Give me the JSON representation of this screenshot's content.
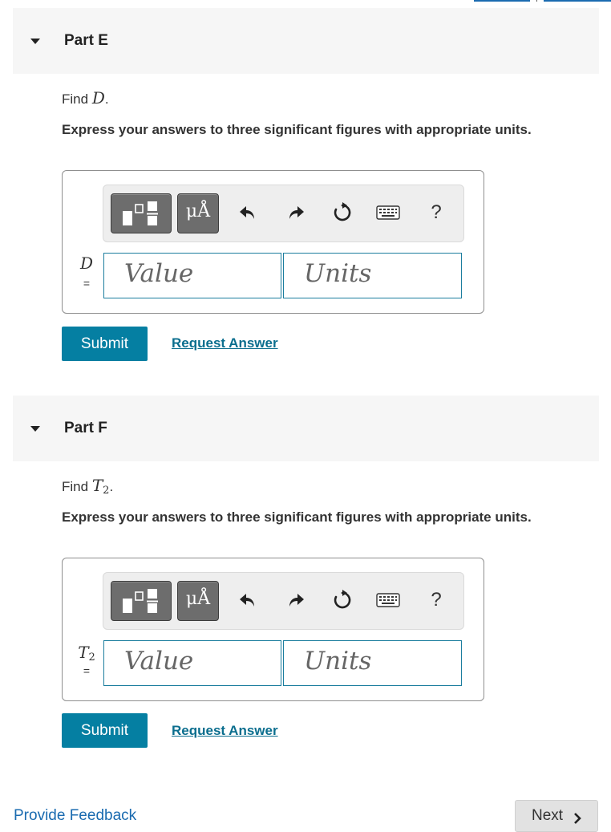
{
  "parts": [
    {
      "title": "Part E",
      "find_prefix": "Find",
      "find_symbol": "D",
      "find_suffix": ".",
      "instructions": "Express your answers to three significant figures with appropriate units.",
      "var_label": "D",
      "var_eq": "=",
      "value_placeholder": "Value",
      "units_placeholder": "Units",
      "units_button": "μÅ",
      "help_symbol": "?",
      "submit_label": "Submit",
      "request_label": "Request Answer"
    },
    {
      "title": "Part F",
      "find_prefix": "Find",
      "find_symbol": "T",
      "find_subscript": "2",
      "find_suffix": ".",
      "instructions": "Express your answers to three significant figures with appropriate units.",
      "var_label": "T",
      "var_label_subscript": "2",
      "var_eq": "=",
      "value_placeholder": "Value",
      "units_placeholder": "Units",
      "units_button": "μÅ",
      "help_symbol": "?",
      "submit_label": "Submit",
      "request_label": "Request Answer"
    }
  ],
  "footer": {
    "feedback_label": "Provide Feedback",
    "next_label": "Next"
  },
  "colors": {
    "submit": "#057fa2",
    "field_border": "#1b7d9e",
    "link": "#1a6bb0",
    "header_bg": "#f6f6f6"
  }
}
